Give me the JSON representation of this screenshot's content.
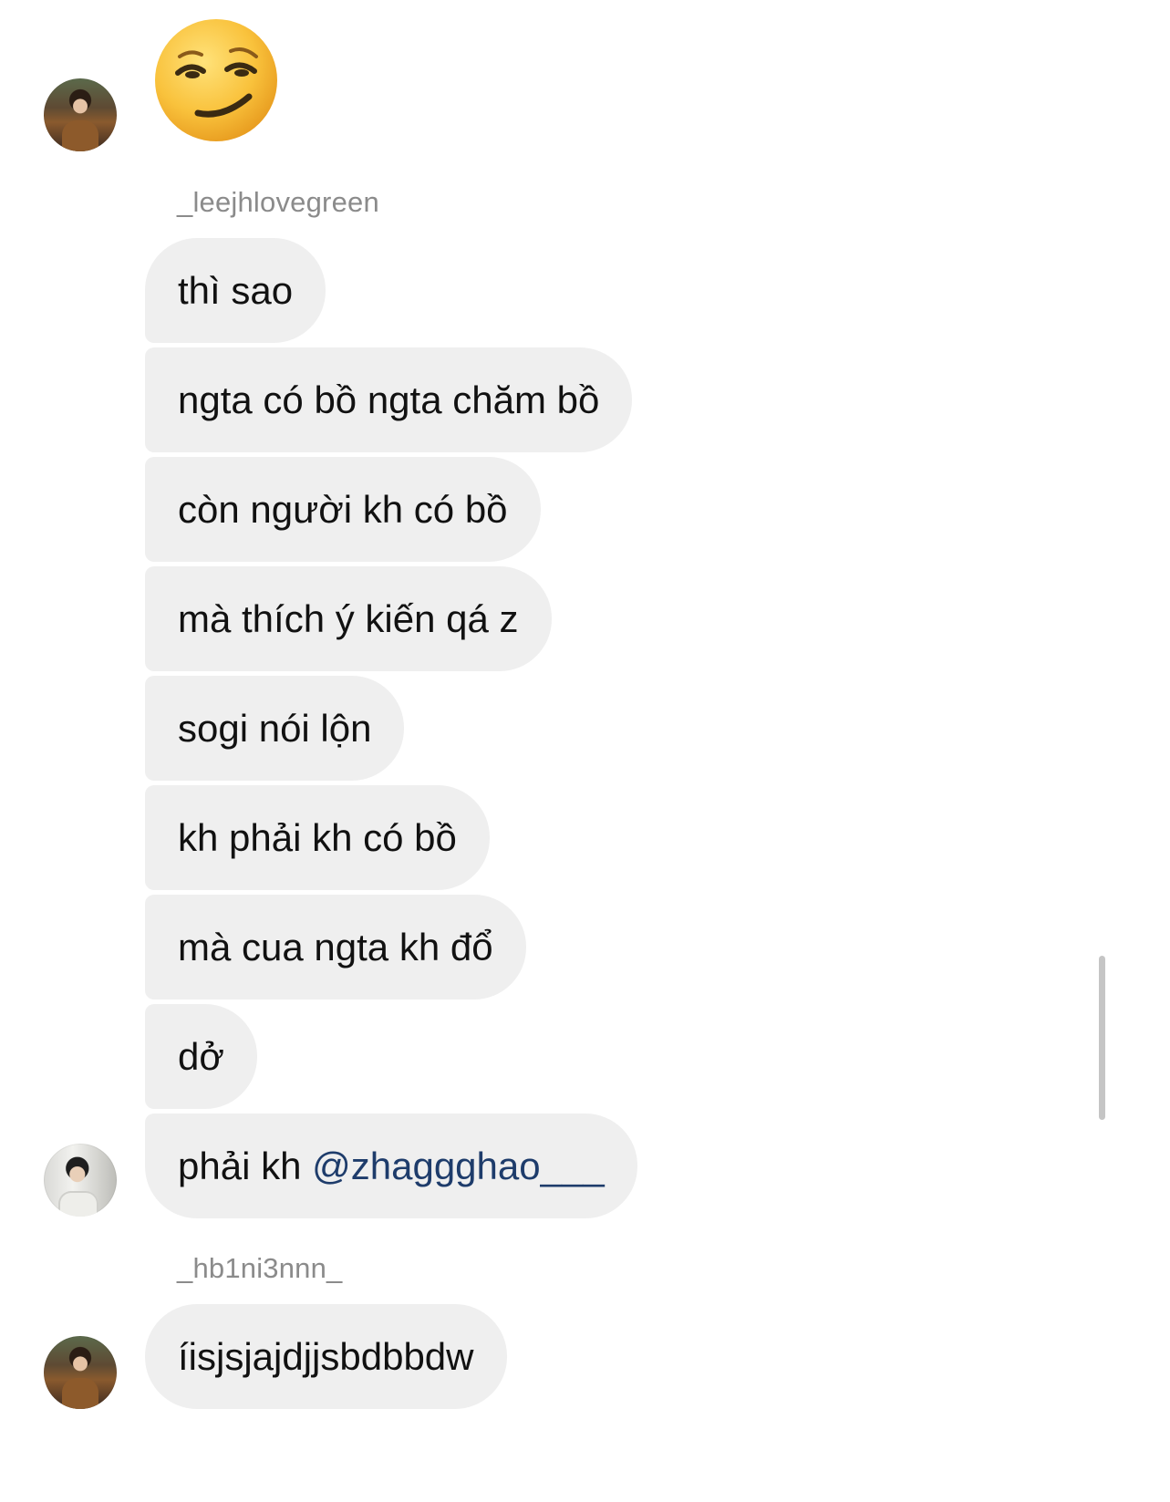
{
  "conversation": {
    "groups": [
      {
        "username": "",
        "emoji": "smirking-face"
      },
      {
        "username": "_leejhlovegreen",
        "messages": [
          "thì sao",
          "ngta có bồ ngta chăm bồ",
          "còn người kh có bồ",
          "mà thích ý kiến qá z",
          "sogi nói lộn",
          "kh phải kh có bồ",
          "mà cua ngta kh đổ",
          "dở"
        ],
        "last_message": {
          "text": "phải kh ",
          "mention": "@zhaggghao___"
        }
      },
      {
        "username": "_hb1ni3nnn_",
        "messages": [
          "íisjsjajdjjsbdbbdw"
        ]
      }
    ]
  },
  "colors": {
    "bubble": "#efefef",
    "username": "#8b8b8b",
    "mention": "#1e3c6b",
    "scrollbar": "#c5c5c5"
  }
}
